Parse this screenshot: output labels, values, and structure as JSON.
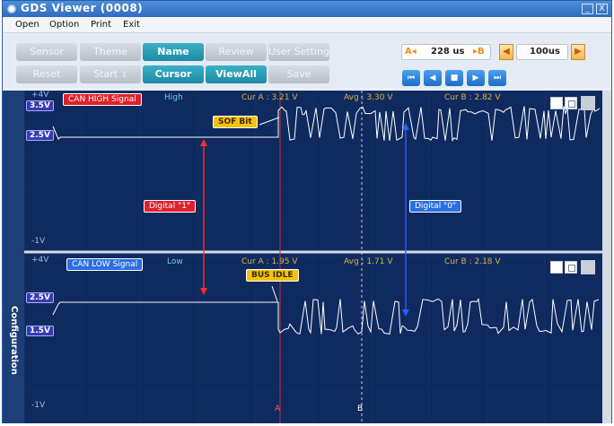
{
  "window": {
    "title": "GDS Viewer (0008)",
    "minimize_glyph": "_",
    "close_glyph": "X"
  },
  "menu": [
    "Open",
    "Option",
    "Print",
    "Exit"
  ],
  "toolbar": {
    "row1": [
      {
        "label": "Sensor",
        "active": false
      },
      {
        "label": "Theme",
        "active": false
      },
      {
        "label": "Name",
        "active": true
      },
      {
        "label": "Review",
        "active": false
      },
      {
        "label": "User Setting",
        "active": false
      }
    ],
    "row2": [
      {
        "label": "Reset",
        "active": false
      },
      {
        "label": "Start",
        "active": false
      },
      {
        "label": "Cursor",
        "active": true
      },
      {
        "label": "ViewAll",
        "active": true
      },
      {
        "label": "Save",
        "active": false
      }
    ],
    "start_spin_glyph": "↕",
    "cursor_a_label": "A◂",
    "cursor_b_label": "▸B",
    "delta_time": "228 us",
    "time_div": "100us",
    "time_prev_glyph": "◀",
    "time_next_glyph": "▶",
    "playback": [
      "⏮",
      "◀",
      "■",
      "▶",
      "⏭"
    ]
  },
  "sidebar_label": "Configuration",
  "channels": [
    {
      "name": "CAN HIGH Signal",
      "level_label": "High",
      "top_scale": "+4V",
      "bottom_scale": "-1V",
      "markers": [
        "3.5V",
        "2.5V"
      ],
      "cur_a": "Cur A : 3.21 V",
      "avg": "Avg : 3.30 V",
      "cur_b": "Cur B : 2.82 V"
    },
    {
      "name": "CAN LOW Signal",
      "level_label": "Low",
      "top_scale": "+4V",
      "bottom_scale": "-1V",
      "markers": [
        "2.5V",
        "1.5V"
      ],
      "cur_a": "Cur A : 1.95 V",
      "avg": "Avg : 1.71 V",
      "cur_b": "Cur B : 2.18 V"
    }
  ],
  "annotations": {
    "sof_bit": "SOF Bit",
    "bus_idle": "BUS IDLE",
    "digital_one": "Digital \"1\"",
    "digital_zero": "Digital \"0\""
  },
  "cursors": {
    "a": "A",
    "b": "B"
  },
  "colors": {
    "scope_bg": "#0f2a5e",
    "trace": "#ffffff",
    "accent_teal": "#1c8aa4",
    "red": "#e0202a",
    "blue": "#2a6fe0",
    "yellow": "#f4c20e"
  }
}
